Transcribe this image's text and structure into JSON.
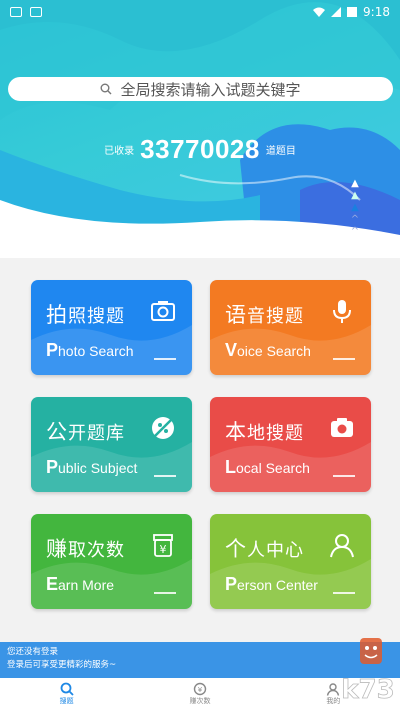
{
  "status_bar": {
    "time": "9:18"
  },
  "search": {
    "placeholder": "全局搜索请输入试题关键字",
    "icon": "search-icon"
  },
  "stats": {
    "prefix": "已收录",
    "count": "33770028",
    "suffix": "道题目"
  },
  "cards": [
    {
      "title_first": "拍",
      "title_rest": "照搜题",
      "en_cap": "P",
      "en_rest": "hoto Search",
      "icon": "camera-icon",
      "color": "#1f87f0"
    },
    {
      "title_first": "语",
      "title_rest": "音搜题",
      "en_cap": "V",
      "en_rest": "oice Search",
      "icon": "microphone-icon",
      "color": "#f37a22"
    },
    {
      "title_first": "公",
      "title_rest": "开题库",
      "en_cap": "P",
      "en_rest": "ublic Subject",
      "icon": "no-tag-icon",
      "color": "#25b1a2"
    },
    {
      "title_first": "本",
      "title_rest": "地搜题",
      "en_cap": "L",
      "en_rest": "ocal Search",
      "icon": "camera-filled-icon",
      "color": "#e94c48"
    },
    {
      "title_first": "赚",
      "title_rest": "取次数",
      "en_cap": "E",
      "en_rest": "arn More",
      "icon": "yen-bag-icon",
      "color": "#43b63e"
    },
    {
      "title_first": "个",
      "title_rest": "人中心",
      "en_cap": "P",
      "en_rest": "erson Center",
      "icon": "person-icon",
      "color": "#86c33a"
    }
  ],
  "login_banner": {
    "line1": "您还没有登录",
    "line2": "登录后可享受更精彩的服务~"
  },
  "nav": [
    {
      "label": "搜题",
      "icon": "search-icon",
      "active": true
    },
    {
      "label": "赚次数",
      "icon": "coin-icon",
      "active": false
    },
    {
      "label": "我的",
      "icon": "person-icon",
      "active": false
    }
  ],
  "watermark": {
    "text": "k73"
  }
}
